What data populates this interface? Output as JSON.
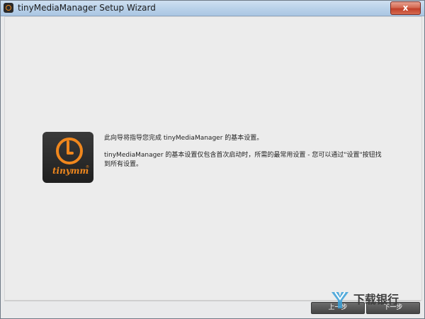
{
  "window": {
    "title": "tinyMediaManager Setup Wizard",
    "close_label": "x"
  },
  "logo": {
    "text": "tinymm",
    "reg": "®"
  },
  "intro": {
    "line1": "此向导将指导您完成 tinyMediaManager 的基本设置。",
    "line2": "tinyMediaManager 的基本设置仅包含首次启动时，所需的最常用设置 - 您可以通过\"设置\"按钮找到所有设置。"
  },
  "buttons": {
    "back": "上一步",
    "next": "下一步"
  },
  "watermark": {
    "text": "下载银行"
  },
  "colors": {
    "accent_orange": "#f0871d",
    "close_red": "#c1402a",
    "button_dark": "#454545"
  }
}
